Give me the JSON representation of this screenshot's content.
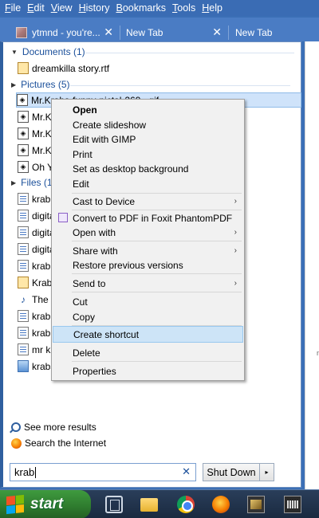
{
  "menubar": {
    "items": [
      {
        "label": "File",
        "ul": "F",
        "rest": "ile"
      },
      {
        "label": "Edit",
        "ul": "E",
        "rest": "dit"
      },
      {
        "label": "View",
        "ul": "V",
        "rest": "iew"
      },
      {
        "label": "History",
        "ul": "H",
        "rest": "istory"
      },
      {
        "label": "Bookmarks",
        "ul": "B",
        "rest": "ookmarks"
      },
      {
        "label": "Tools",
        "ul": "T",
        "rest": "ools"
      },
      {
        "label": "Help",
        "ul": "H",
        "rest": "elp"
      }
    ]
  },
  "tabs": [
    {
      "title": "ytmnd - you're..."
    },
    {
      "title": "New Tab"
    },
    {
      "title": "New Tab"
    }
  ],
  "start_menu": {
    "sections": [
      {
        "header": "Documents (1)",
        "items": [
          {
            "name": "dreamkilla story.rtf",
            "icon": "rtf-file-icon"
          }
        ]
      },
      {
        "header": "Pictures (5)",
        "items": [
          {
            "name": "Mr.Krabs-funny-pictal-269...gif",
            "icon": "image-file-icon",
            "selected": true
          },
          {
            "name": "Mr.Kra",
            "icon": "image-file-icon"
          },
          {
            "name": "Mr.Kra",
            "icon": "image-file-icon"
          },
          {
            "name": "Mr.Kra",
            "icon": "image-file-icon"
          },
          {
            "name": "Oh Ye",
            "icon": "image-file-icon"
          }
        ]
      },
      {
        "header": "Files (11)",
        "items": [
          {
            "name": "krab.n",
            "icon": "document-file-icon"
          },
          {
            "name": "digita",
            "icon": "document-file-icon"
          },
          {
            "name": "digita",
            "icon": "document-file-icon"
          },
          {
            "name": "digita",
            "icon": "document-file-icon"
          },
          {
            "name": "krab t",
            "icon": "document-file-icon"
          },
          {
            "name": "Krab V",
            "icon": "document-file-icon"
          },
          {
            "name": "The Ki",
            "icon": "music-file-icon"
          },
          {
            "name": "krab b",
            "icon": "document-file-icon"
          },
          {
            "name": "krablo",
            "icon": "document-file-icon"
          },
          {
            "name": "mr kra",
            "icon": "document-file-icon"
          },
          {
            "name": "krabsc",
            "icon": "picture-file-icon"
          }
        ]
      }
    ],
    "see_more": "See more results",
    "search_internet": "Search the Internet",
    "search_value": "krab",
    "clear_glyph": "✕",
    "shutdown_label": "Shut Down",
    "shutdown_arrow": "▸"
  },
  "context_menu": {
    "items": [
      {
        "label": "Open",
        "bold": true
      },
      {
        "label": "Create slideshow"
      },
      {
        "label": "Edit with GIMP"
      },
      {
        "label": "Print"
      },
      {
        "label": "Set as desktop background"
      },
      {
        "label": "Edit"
      },
      {
        "label": "Cast to Device",
        "submenu": true
      },
      {
        "label": "Convert to PDF in Foxit PhantomPDF",
        "icon": "pdf-icon"
      },
      {
        "label": "Open with",
        "submenu": true
      },
      {
        "label": "Share with",
        "submenu": true
      },
      {
        "label": "Restore previous versions"
      },
      {
        "label": "Send to",
        "submenu": true
      },
      {
        "label": "Cut"
      },
      {
        "label": "Copy"
      },
      {
        "label": "Create shortcut",
        "highlighted": true
      },
      {
        "label": "Delete"
      },
      {
        "label": "Properties"
      }
    ],
    "submenu_glyph": "›"
  },
  "taskbar": {
    "start_label": "start",
    "icons": [
      "task-view-icon",
      "folder-icon",
      "chrome-icon",
      "firefox-icon",
      "app-icon",
      "audio-app-icon"
    ]
  },
  "right_strip_hint": "n"
}
